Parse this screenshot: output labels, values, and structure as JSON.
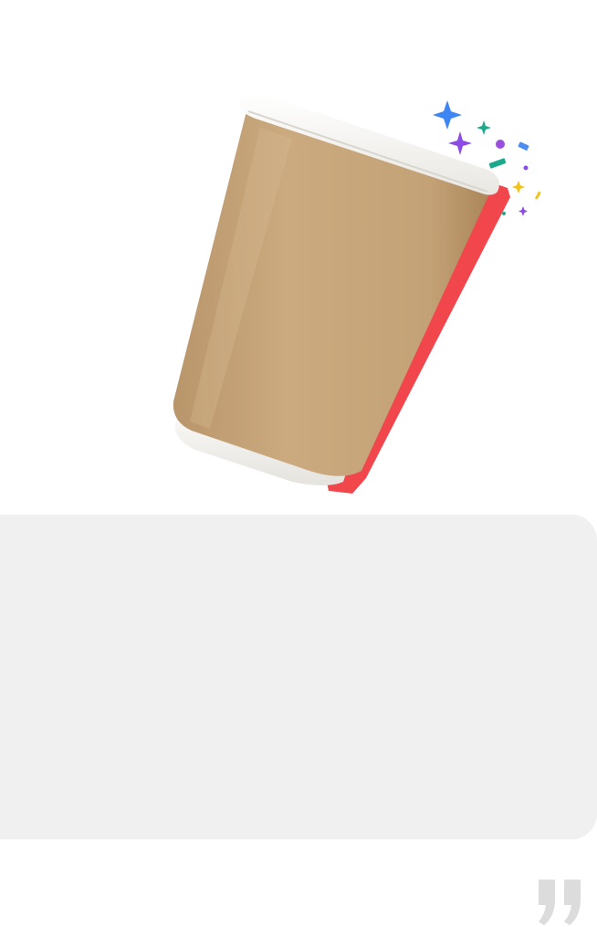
{
  "hero": {
    "image": "coffee-cup-with-confetti",
    "cup_color": "#c7a57a",
    "rim_color": "#f7f6f2",
    "shadow_color": "#f2464d",
    "confetti_colors": [
      "#3d84f5",
      "#8c4be6",
      "#1ba98c",
      "#f2c31a",
      "#4c8df0"
    ]
  },
  "content_panel": {
    "background": "#f0f0f0"
  },
  "quote_mark": {
    "icon": "closing-quote-icon",
    "color": "#dcdcdc"
  }
}
